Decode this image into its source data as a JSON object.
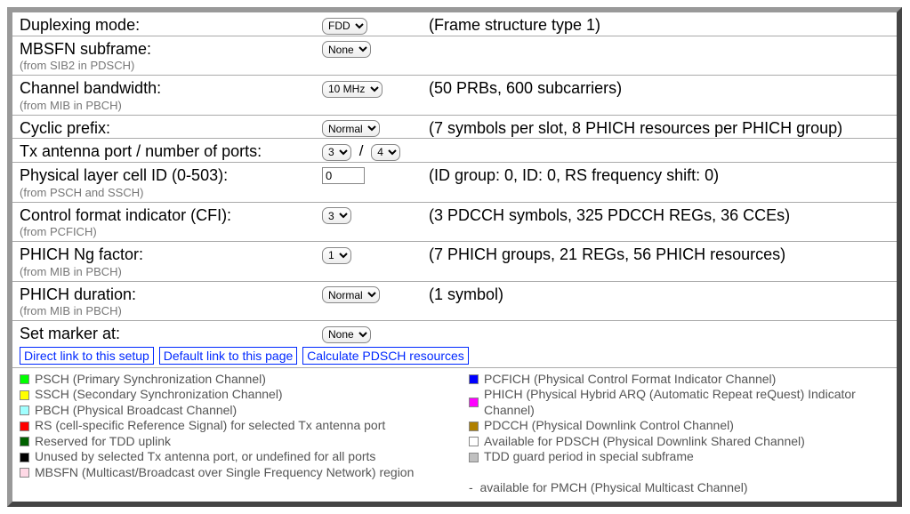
{
  "rows": {
    "duplexing": {
      "label": "Duplexing mode:",
      "info": "(Frame structure type 1)",
      "value": "FDD"
    },
    "mbsfn": {
      "label": "MBSFN subframe:",
      "sublabel": "(from SIB2 in PDSCH)",
      "value": "None"
    },
    "bandwidth": {
      "label": "Channel bandwidth:",
      "sublabel": "(from MIB in PBCH)",
      "value": "10 MHz",
      "info": "(50 PRBs, 600 subcarriers)"
    },
    "cp": {
      "label": "Cyclic prefix:",
      "value": "Normal",
      "info": "(7 symbols per slot, 8 PHICH resources per PHICH group)"
    },
    "txport": {
      "label": "Tx antenna port / number of ports:",
      "port": "3",
      "num": "4",
      "sep": "/"
    },
    "cellid": {
      "label": "Physical layer cell ID (0-503):",
      "sublabel": "(from PSCH and SSCH)",
      "value": "0",
      "info": "(ID group: 0, ID: 0, RS frequency shift: 0)"
    },
    "cfi": {
      "label": "Control format indicator (CFI):",
      "sublabel": "(from PCFICH)",
      "value": "3",
      "info": "(3 PDCCH symbols, 325 PDCCH REGs, 36 CCEs)"
    },
    "phichng": {
      "label": "PHICH Ng factor:",
      "sublabel": "(from MIB in PBCH)",
      "value": "1",
      "info": "(7 PHICH groups, 21 REGs, 56 PHICH resources)"
    },
    "phichdur": {
      "label": "PHICH duration:",
      "sublabel": "(from MIB in PBCH)",
      "value": "Normal",
      "info": "(1 symbol)"
    },
    "marker": {
      "label": "Set marker at:",
      "value": "None"
    }
  },
  "links": {
    "direct": "Direct link to this setup",
    "default": "Default link to this page",
    "calc": "Calculate PDSCH resources"
  },
  "legend": {
    "psch": "PSCH (Primary Synchronization Channel)",
    "ssch": "SSCH (Secondary Synchronization Channel)",
    "pbch": "PBCH (Physical Broadcast Channel)",
    "rs": "RS (cell-specific Reference Signal) for selected Tx antenna port",
    "rtdd": "Reserved for TDD uplink",
    "unused": "Unused by selected Tx antenna port, or undefined for all ports",
    "mbsfn": "MBSFN (Multicast/Broadcast over Single Frequency Network) region",
    "pcfich": "PCFICH (Physical Control Format Indicator Channel)",
    "phich": "PHICH (Physical Hybrid ARQ (Automatic Repeat reQuest) Indicator Channel)",
    "pdcch": "PDCCH (Physical Downlink Control Channel)",
    "avail": "Available for PDSCH (Physical Downlink Shared Channel)",
    "guard": "TDD guard period in special subframe",
    "pmch": "-  available for PMCH (Physical Multicast Channel)"
  },
  "colors": {
    "psch": "#00ff00",
    "ssch": "#ffff00",
    "pbch": "#a0ffff",
    "rs": "#ff0000",
    "rtdd": "#006000",
    "unused": "#000000",
    "mbsfn": "#ffd9e6",
    "pcfich": "#0000ff",
    "phich": "#ff00ff",
    "pdcch": "#b08000",
    "avail": "#ffffff",
    "guard": "#c0c0c0"
  }
}
